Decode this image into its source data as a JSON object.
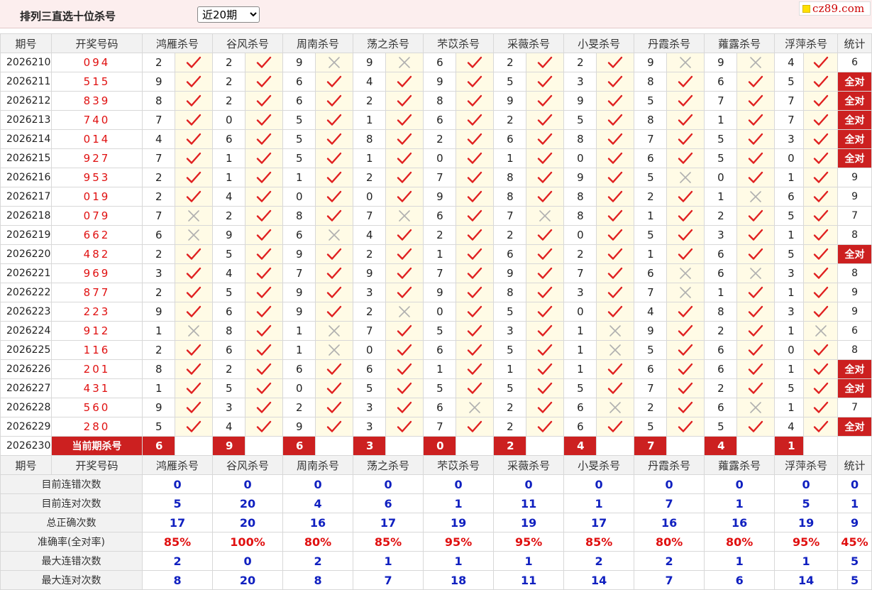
{
  "page": {
    "title": "排列三直选十位杀号",
    "period_selected": "近20期",
    "logo_text": "cz89.com"
  },
  "headers": {
    "period": "期号",
    "draw": "开奖号码",
    "experts": [
      "鸿雁杀号",
      "谷风杀号",
      "周南杀号",
      "荡之杀号",
      "芣苡杀号",
      "采薇杀号",
      "小旻杀号",
      "丹霞杀号",
      "蕹露杀号",
      "浮萍杀号"
    ],
    "stat": "统计"
  },
  "rows": [
    {
      "period": "2026210",
      "draw": "094",
      "kills": [
        2,
        2,
        9,
        9,
        6,
        2,
        2,
        9,
        9,
        4
      ],
      "ok": [
        1,
        1,
        0,
        0,
        1,
        1,
        1,
        0,
        0,
        1
      ],
      "stat": "6"
    },
    {
      "period": "2026211",
      "draw": "515",
      "kills": [
        9,
        2,
        6,
        4,
        9,
        5,
        3,
        8,
        6,
        5
      ],
      "ok": [
        1,
        1,
        1,
        1,
        1,
        1,
        1,
        1,
        1,
        1
      ],
      "stat": "全对"
    },
    {
      "period": "2026212",
      "draw": "839",
      "kills": [
        8,
        2,
        6,
        2,
        8,
        9,
        9,
        5,
        7,
        7
      ],
      "ok": [
        1,
        1,
        1,
        1,
        1,
        1,
        1,
        1,
        1,
        1
      ],
      "stat": "全对"
    },
    {
      "period": "2026213",
      "draw": "740",
      "kills": [
        7,
        0,
        5,
        1,
        6,
        2,
        5,
        8,
        1,
        7
      ],
      "ok": [
        1,
        1,
        1,
        1,
        1,
        1,
        1,
        1,
        1,
        1
      ],
      "stat": "全对"
    },
    {
      "period": "2026214",
      "draw": "014",
      "kills": [
        4,
        6,
        5,
        8,
        2,
        6,
        8,
        7,
        5,
        3
      ],
      "ok": [
        1,
        1,
        1,
        1,
        1,
        1,
        1,
        1,
        1,
        1
      ],
      "stat": "全对"
    },
    {
      "period": "2026215",
      "draw": "927",
      "kills": [
        7,
        1,
        5,
        1,
        0,
        1,
        0,
        6,
        5,
        0
      ],
      "ok": [
        1,
        1,
        1,
        1,
        1,
        1,
        1,
        1,
        1,
        1
      ],
      "stat": "全对"
    },
    {
      "period": "2026216",
      "draw": "953",
      "kills": [
        2,
        1,
        1,
        2,
        7,
        8,
        9,
        5,
        0,
        1
      ],
      "ok": [
        1,
        1,
        1,
        1,
        1,
        1,
        1,
        0,
        1,
        1
      ],
      "stat": "9"
    },
    {
      "period": "2026217",
      "draw": "019",
      "kills": [
        2,
        4,
        0,
        0,
        9,
        8,
        8,
        2,
        1,
        6
      ],
      "ok": [
        1,
        1,
        1,
        1,
        1,
        1,
        1,
        1,
        0,
        1
      ],
      "stat": "9"
    },
    {
      "period": "2026218",
      "draw": "079",
      "kills": [
        7,
        2,
        8,
        7,
        6,
        7,
        8,
        1,
        2,
        5
      ],
      "ok": [
        0,
        1,
        1,
        0,
        1,
        0,
        1,
        1,
        1,
        1
      ],
      "stat": "7"
    },
    {
      "period": "2026219",
      "draw": "662",
      "kills": [
        6,
        9,
        6,
        4,
        2,
        2,
        0,
        5,
        3,
        1
      ],
      "ok": [
        0,
        1,
        0,
        1,
        1,
        1,
        1,
        1,
        1,
        1
      ],
      "stat": "8"
    },
    {
      "period": "2026220",
      "draw": "482",
      "kills": [
        2,
        5,
        9,
        2,
        1,
        6,
        2,
        1,
        6,
        5
      ],
      "ok": [
        1,
        1,
        1,
        1,
        1,
        1,
        1,
        1,
        1,
        1
      ],
      "stat": "全对"
    },
    {
      "period": "2026221",
      "draw": "969",
      "kills": [
        3,
        4,
        7,
        9,
        7,
        9,
        7,
        6,
        6,
        3
      ],
      "ok": [
        1,
        1,
        1,
        1,
        1,
        1,
        1,
        0,
        0,
        1
      ],
      "stat": "8"
    },
    {
      "period": "2026222",
      "draw": "877",
      "kills": [
        2,
        5,
        9,
        3,
        9,
        8,
        3,
        7,
        1,
        1
      ],
      "ok": [
        1,
        1,
        1,
        1,
        1,
        1,
        1,
        0,
        1,
        1
      ],
      "stat": "9"
    },
    {
      "period": "2026223",
      "draw": "223",
      "kills": [
        9,
        6,
        9,
        2,
        0,
        5,
        0,
        4,
        8,
        3
      ],
      "ok": [
        1,
        1,
        1,
        0,
        1,
        1,
        1,
        1,
        1,
        1
      ],
      "stat": "9"
    },
    {
      "period": "2026224",
      "draw": "912",
      "kills": [
        1,
        8,
        1,
        7,
        5,
        3,
        1,
        9,
        2,
        1
      ],
      "ok": [
        0,
        1,
        0,
        1,
        1,
        1,
        0,
        1,
        1,
        0
      ],
      "stat": "6"
    },
    {
      "period": "2026225",
      "draw": "116",
      "kills": [
        2,
        6,
        1,
        0,
        6,
        5,
        1,
        5,
        6,
        0
      ],
      "ok": [
        1,
        1,
        0,
        1,
        1,
        1,
        0,
        1,
        1,
        1
      ],
      "stat": "8"
    },
    {
      "period": "2026226",
      "draw": "201",
      "kills": [
        8,
        2,
        6,
        6,
        1,
        1,
        1,
        6,
        6,
        1
      ],
      "ok": [
        1,
        1,
        1,
        1,
        1,
        1,
        1,
        1,
        1,
        1
      ],
      "stat": "全对"
    },
    {
      "period": "2026227",
      "draw": "431",
      "kills": [
        1,
        5,
        0,
        5,
        5,
        5,
        5,
        7,
        2,
        5
      ],
      "ok": [
        1,
        1,
        1,
        1,
        1,
        1,
        1,
        1,
        1,
        1
      ],
      "stat": "全对"
    },
    {
      "period": "2026228",
      "draw": "560",
      "kills": [
        9,
        3,
        2,
        3,
        6,
        2,
        6,
        2,
        6,
        1
      ],
      "ok": [
        1,
        1,
        1,
        1,
        0,
        1,
        0,
        1,
        0,
        1
      ],
      "stat": "7"
    },
    {
      "period": "2026229",
      "draw": "280",
      "kills": [
        5,
        4,
        9,
        3,
        7,
        2,
        6,
        5,
        5,
        4
      ],
      "ok": [
        1,
        1,
        1,
        1,
        1,
        1,
        1,
        1,
        1,
        1
      ],
      "stat": "全对"
    }
  ],
  "current": {
    "period": "2026230",
    "label": "当前期杀号",
    "kills": [
      6,
      9,
      6,
      3,
      0,
      2,
      4,
      7,
      4,
      1
    ]
  },
  "stats": [
    {
      "label": "目前连错次数",
      "values": [
        "0",
        "0",
        "0",
        "0",
        "0",
        "0",
        "0",
        "0",
        "0",
        "0"
      ],
      "total": "0"
    },
    {
      "label": "目前连对次数",
      "values": [
        "5",
        "20",
        "4",
        "6",
        "1",
        "11",
        "1",
        "7",
        "1",
        "5"
      ],
      "total": "1"
    },
    {
      "label": "总正确次数",
      "values": [
        "17",
        "20",
        "16",
        "17",
        "19",
        "19",
        "17",
        "16",
        "16",
        "19"
      ],
      "total": "9"
    },
    {
      "label": "准确率(全对率)",
      "values": [
        "85%",
        "100%",
        "80%",
        "85%",
        "95%",
        "95%",
        "85%",
        "80%",
        "80%",
        "95%"
      ],
      "total": "45%"
    },
    {
      "label": "最大连错次数",
      "values": [
        "2",
        "0",
        "2",
        "1",
        "1",
        "1",
        "2",
        "2",
        "1",
        "1"
      ],
      "total": "5"
    },
    {
      "label": "最大连对次数",
      "values": [
        "8",
        "20",
        "8",
        "7",
        "18",
        "11",
        "14",
        "7",
        "6",
        "14"
      ],
      "total": "5"
    }
  ],
  "icons": {
    "correct": "check-icon",
    "wrong": "cross-icon"
  },
  "colors": {
    "check": "#e02020",
    "cross": "#b0b0b0",
    "accent": "#cc2020",
    "stat_blue": "#1020c0",
    "draw_red": "#e01010"
  }
}
